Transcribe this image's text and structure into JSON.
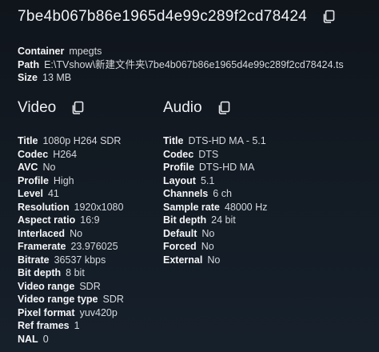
{
  "file": {
    "hash": "7be4b067b86e1965d4e99c289f2cd78424",
    "container_label": "Container",
    "container": "mpegts",
    "path_label": "Path",
    "path": "E:\\TVshow\\新建文件夹\\7be4b067b86e1965d4e99c289f2cd78424.ts",
    "size_label": "Size",
    "size": "13 MB"
  },
  "video": {
    "heading": "Video",
    "props": [
      {
        "label": "Title",
        "value": "1080p H264 SDR"
      },
      {
        "label": "Codec",
        "value": "H264"
      },
      {
        "label": "AVC",
        "value": "No"
      },
      {
        "label": "Profile",
        "value": "High"
      },
      {
        "label": "Level",
        "value": "41"
      },
      {
        "label": "Resolution",
        "value": "1920x1080"
      },
      {
        "label": "Aspect ratio",
        "value": "16:9"
      },
      {
        "label": "Interlaced",
        "value": "No"
      },
      {
        "label": "Framerate",
        "value": "23.976025"
      },
      {
        "label": "Bitrate",
        "value": "36537 kbps"
      },
      {
        "label": "Bit depth",
        "value": "8 bit"
      },
      {
        "label": "Video range",
        "value": "SDR"
      },
      {
        "label": "Video range type",
        "value": "SDR"
      },
      {
        "label": "Pixel format",
        "value": "yuv420p"
      },
      {
        "label": "Ref frames",
        "value": "1"
      },
      {
        "label": "NAL",
        "value": "0"
      }
    ]
  },
  "audio": {
    "heading": "Audio",
    "props": [
      {
        "label": "Title",
        "value": "DTS-HD MA - 5.1"
      },
      {
        "label": "Codec",
        "value": "DTS"
      },
      {
        "label": "Profile",
        "value": "DTS-HD MA"
      },
      {
        "label": "Layout",
        "value": "5.1"
      },
      {
        "label": "Channels",
        "value": "6 ch"
      },
      {
        "label": "Sample rate",
        "value": "48000 Hz"
      },
      {
        "label": "Bit depth",
        "value": "24 bit"
      },
      {
        "label": "Default",
        "value": "No"
      },
      {
        "label": "Forced",
        "value": "No"
      },
      {
        "label": "External",
        "value": "No"
      }
    ]
  },
  "icons": {
    "copy": "copy-icon"
  }
}
